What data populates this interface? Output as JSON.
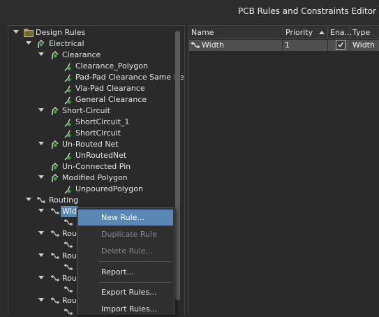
{
  "window": {
    "title": "PCB Rules and Constraints Editor"
  },
  "tree": {
    "root": "Design Rules",
    "electrical": "Electrical",
    "clearance": "Clearance",
    "clearance_rules": [
      "Clearance_Polygon",
      "Pad-Pad Clearance Same Ne",
      "Via-Pad Clearance",
      "General Clearance"
    ],
    "short_circuit": "Short-Circuit",
    "short_circuit_rules": [
      "ShortCircuit_1",
      "ShortCircuit"
    ],
    "unrouted": "Un-Routed Net",
    "unrouted_rules": [
      "UnRoutedNet"
    ],
    "unconnected_pin": "Un-Connected Pin",
    "modified_polygon": "Modified Polygon",
    "modified_polygon_rules": [
      "UnpouredPolygon"
    ],
    "routing": "Routing",
    "width": "Wid",
    "routing_partial": [
      "Rou",
      "Rou",
      "Rou",
      "Rou"
    ]
  },
  "grid": {
    "columns": [
      "Name",
      "Priority",
      "Ena...",
      "Type"
    ],
    "rows": [
      {
        "name": "Width",
        "priority": "1",
        "enabled": true,
        "type": "Width"
      }
    ]
  },
  "context_menu": {
    "items": [
      "New Rule...",
      "Duplicate Rule",
      "Delete Rule...",
      "Report...",
      "Export Rules...",
      "Import Rules..."
    ]
  },
  "colors": {
    "selection": "#5b87b4",
    "background": "#2b2b2b"
  }
}
